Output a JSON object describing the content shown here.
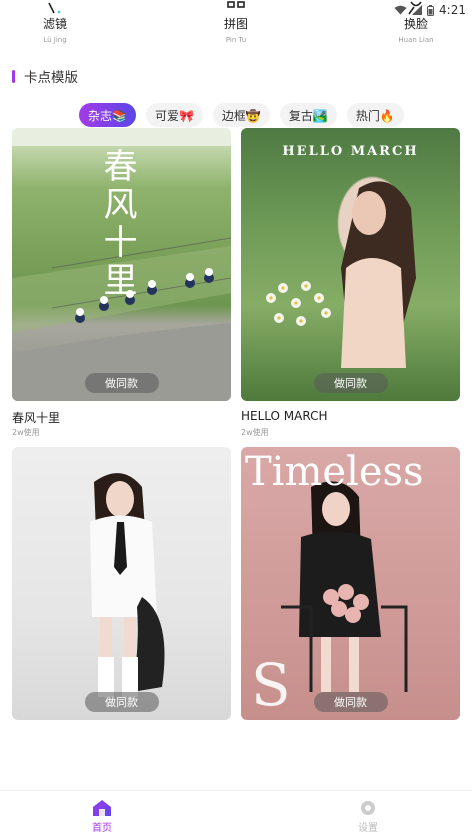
{
  "tools": [
    {
      "name": "滤镜",
      "pinyin": "Lü Jing",
      "icon": "filter-icon"
    },
    {
      "name": "拼图",
      "pinyin": "Pin Tu",
      "icon": "puzzle-icon"
    },
    {
      "name": "换脸",
      "pinyin": "Huan Lian",
      "icon": "face-swap-icon"
    }
  ],
  "status": {
    "time": "4:21"
  },
  "section": {
    "title": "卡点模版"
  },
  "tabs": [
    {
      "label": "杂志📚",
      "active": true
    },
    {
      "label": "可爱🎀",
      "active": false
    },
    {
      "label": "边框🤠",
      "active": false
    },
    {
      "label": "复古🏞️",
      "active": false
    },
    {
      "label": "热门🔥",
      "active": false
    }
  ],
  "cards": [
    {
      "title": "春风十里",
      "uses": "2w使用",
      "button": "做同款",
      "overlay": "春风十里"
    },
    {
      "title": "HELLO MARCH",
      "uses": "2w使用",
      "button": "做同款",
      "overlay": "HELLO MARCH"
    },
    {
      "title": "",
      "uses": "",
      "button": "做同款",
      "overlay": ""
    },
    {
      "title": "",
      "uses": "",
      "button": "做同款",
      "overlay": "Timeless"
    }
  ],
  "nav": {
    "home": "首页",
    "settings": "设置"
  },
  "colors": {
    "accent": "#a23be6",
    "accent2": "#5b46e8"
  }
}
